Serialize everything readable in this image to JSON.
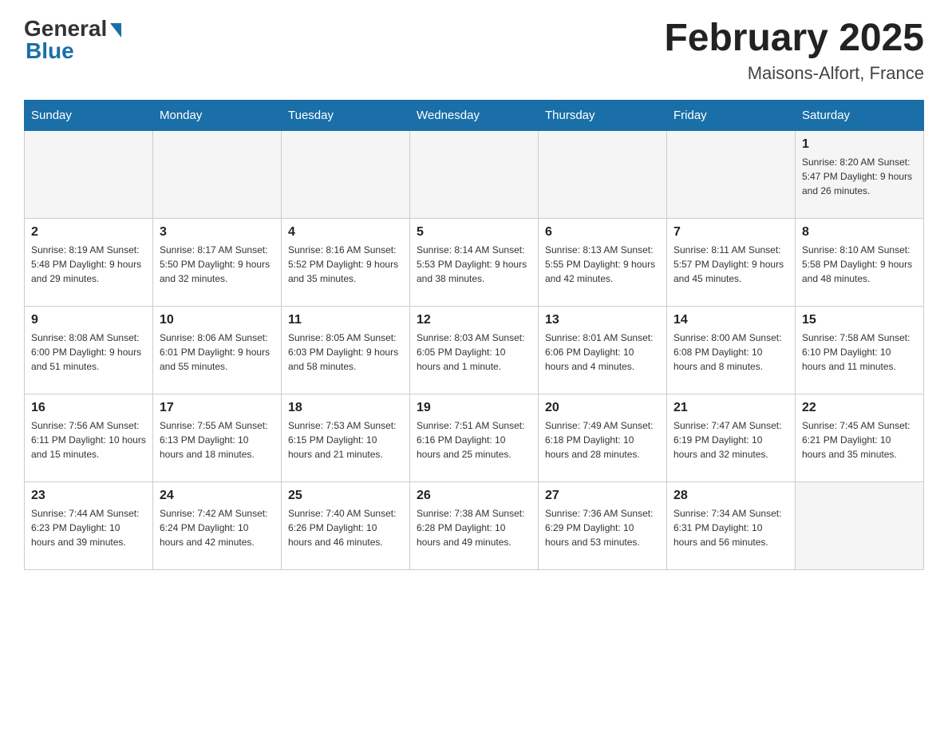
{
  "header": {
    "logo_general": "General",
    "logo_blue": "Blue",
    "month_year": "February 2025",
    "location": "Maisons-Alfort, France"
  },
  "days_of_week": [
    "Sunday",
    "Monday",
    "Tuesday",
    "Wednesday",
    "Thursday",
    "Friday",
    "Saturday"
  ],
  "weeks": [
    [
      {
        "day": "",
        "info": ""
      },
      {
        "day": "",
        "info": ""
      },
      {
        "day": "",
        "info": ""
      },
      {
        "day": "",
        "info": ""
      },
      {
        "day": "",
        "info": ""
      },
      {
        "day": "",
        "info": ""
      },
      {
        "day": "1",
        "info": "Sunrise: 8:20 AM\nSunset: 5:47 PM\nDaylight: 9 hours and 26 minutes."
      }
    ],
    [
      {
        "day": "2",
        "info": "Sunrise: 8:19 AM\nSunset: 5:48 PM\nDaylight: 9 hours and 29 minutes."
      },
      {
        "day": "3",
        "info": "Sunrise: 8:17 AM\nSunset: 5:50 PM\nDaylight: 9 hours and 32 minutes."
      },
      {
        "day": "4",
        "info": "Sunrise: 8:16 AM\nSunset: 5:52 PM\nDaylight: 9 hours and 35 minutes."
      },
      {
        "day": "5",
        "info": "Sunrise: 8:14 AM\nSunset: 5:53 PM\nDaylight: 9 hours and 38 minutes."
      },
      {
        "day": "6",
        "info": "Sunrise: 8:13 AM\nSunset: 5:55 PM\nDaylight: 9 hours and 42 minutes."
      },
      {
        "day": "7",
        "info": "Sunrise: 8:11 AM\nSunset: 5:57 PM\nDaylight: 9 hours and 45 minutes."
      },
      {
        "day": "8",
        "info": "Sunrise: 8:10 AM\nSunset: 5:58 PM\nDaylight: 9 hours and 48 minutes."
      }
    ],
    [
      {
        "day": "9",
        "info": "Sunrise: 8:08 AM\nSunset: 6:00 PM\nDaylight: 9 hours and 51 minutes."
      },
      {
        "day": "10",
        "info": "Sunrise: 8:06 AM\nSunset: 6:01 PM\nDaylight: 9 hours and 55 minutes."
      },
      {
        "day": "11",
        "info": "Sunrise: 8:05 AM\nSunset: 6:03 PM\nDaylight: 9 hours and 58 minutes."
      },
      {
        "day": "12",
        "info": "Sunrise: 8:03 AM\nSunset: 6:05 PM\nDaylight: 10 hours and 1 minute."
      },
      {
        "day": "13",
        "info": "Sunrise: 8:01 AM\nSunset: 6:06 PM\nDaylight: 10 hours and 4 minutes."
      },
      {
        "day": "14",
        "info": "Sunrise: 8:00 AM\nSunset: 6:08 PM\nDaylight: 10 hours and 8 minutes."
      },
      {
        "day": "15",
        "info": "Sunrise: 7:58 AM\nSunset: 6:10 PM\nDaylight: 10 hours and 11 minutes."
      }
    ],
    [
      {
        "day": "16",
        "info": "Sunrise: 7:56 AM\nSunset: 6:11 PM\nDaylight: 10 hours and 15 minutes."
      },
      {
        "day": "17",
        "info": "Sunrise: 7:55 AM\nSunset: 6:13 PM\nDaylight: 10 hours and 18 minutes."
      },
      {
        "day": "18",
        "info": "Sunrise: 7:53 AM\nSunset: 6:15 PM\nDaylight: 10 hours and 21 minutes."
      },
      {
        "day": "19",
        "info": "Sunrise: 7:51 AM\nSunset: 6:16 PM\nDaylight: 10 hours and 25 minutes."
      },
      {
        "day": "20",
        "info": "Sunrise: 7:49 AM\nSunset: 6:18 PM\nDaylight: 10 hours and 28 minutes."
      },
      {
        "day": "21",
        "info": "Sunrise: 7:47 AM\nSunset: 6:19 PM\nDaylight: 10 hours and 32 minutes."
      },
      {
        "day": "22",
        "info": "Sunrise: 7:45 AM\nSunset: 6:21 PM\nDaylight: 10 hours and 35 minutes."
      }
    ],
    [
      {
        "day": "23",
        "info": "Sunrise: 7:44 AM\nSunset: 6:23 PM\nDaylight: 10 hours and 39 minutes."
      },
      {
        "day": "24",
        "info": "Sunrise: 7:42 AM\nSunset: 6:24 PM\nDaylight: 10 hours and 42 minutes."
      },
      {
        "day": "25",
        "info": "Sunrise: 7:40 AM\nSunset: 6:26 PM\nDaylight: 10 hours and 46 minutes."
      },
      {
        "day": "26",
        "info": "Sunrise: 7:38 AM\nSunset: 6:28 PM\nDaylight: 10 hours and 49 minutes."
      },
      {
        "day": "27",
        "info": "Sunrise: 7:36 AM\nSunset: 6:29 PM\nDaylight: 10 hours and 53 minutes."
      },
      {
        "day": "28",
        "info": "Sunrise: 7:34 AM\nSunset: 6:31 PM\nDaylight: 10 hours and 56 minutes."
      },
      {
        "day": "",
        "info": ""
      }
    ]
  ]
}
